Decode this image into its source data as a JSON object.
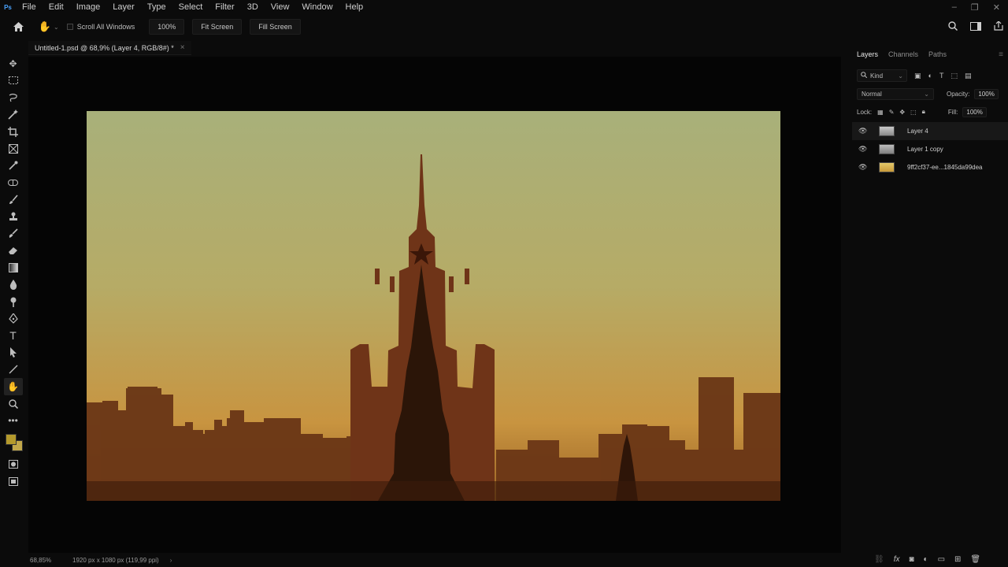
{
  "app": {
    "logo": "Ps",
    "menu": [
      "File",
      "Edit",
      "Image",
      "Layer",
      "Type",
      "Select",
      "Filter",
      "3D",
      "View",
      "Window",
      "Help"
    ],
    "window_controls": [
      "–",
      "❐",
      "✕"
    ]
  },
  "options_bar": {
    "scroll_all_windows": "Scroll All Windows",
    "zoom_button": "100%",
    "fit_screen": "Fit Screen",
    "fill_screen": "Fill Screen"
  },
  "document": {
    "tab_title": "Untitled-1.psd @ 68,9% (Layer 4, RGB/8#) *",
    "close": "×"
  },
  "status_bar": {
    "zoom": "68,85%",
    "dimensions": "1920 px x 1080 px (119,99 ppi)",
    "arrow": "›"
  },
  "colors": {
    "foreground": "#b49a2c",
    "background": "#c2a84a",
    "sky_top": "#a8b07a",
    "sky_bottom": "#c89440",
    "silhouette": "#5a2c12"
  },
  "layers_panel": {
    "tabs": [
      "Layers",
      "Channels",
      "Paths"
    ],
    "active_tab": "Layers",
    "filter_kind": "Kind",
    "blend_mode": "Normal",
    "opacity_label": "Opacity:",
    "opacity_value": "100%",
    "lock_label": "Lock:",
    "fill_label": "Fill:",
    "fill_value": "100%",
    "layers": [
      {
        "name": "Layer 4",
        "selected": true
      },
      {
        "name": "Layer 1 copy",
        "selected": false
      },
      {
        "name": "9ff2cf37-ee...1845da99dea",
        "selected": false
      }
    ]
  }
}
